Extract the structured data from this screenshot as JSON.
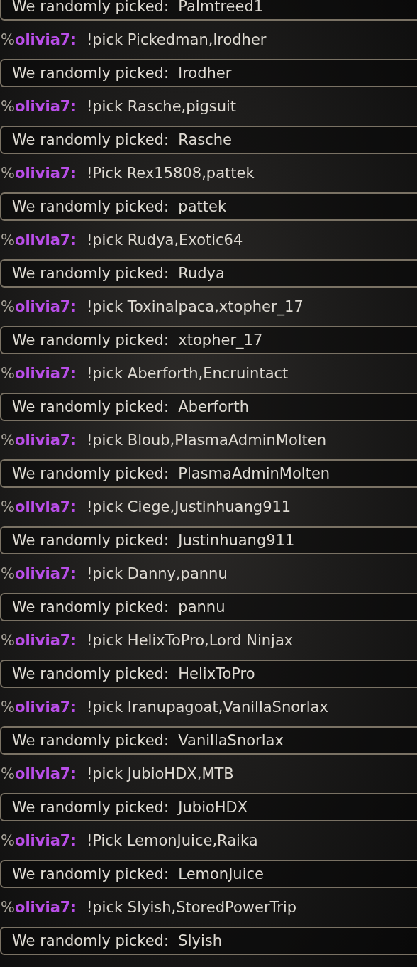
{
  "entries": [
    {
      "kind": "result",
      "text": "We randomly picked:  Palmtreed1"
    },
    {
      "kind": "chat",
      "rank": "%",
      "user": "olivia7:",
      "text": "!pick Pickedman,lrodher"
    },
    {
      "kind": "result",
      "text": "We randomly picked:  lrodher"
    },
    {
      "kind": "chat",
      "rank": "%",
      "user": "olivia7:",
      "text": "!pick Rasche,pigsuit"
    },
    {
      "kind": "result",
      "text": "We randomly picked:  Rasche"
    },
    {
      "kind": "chat",
      "rank": "%",
      "user": "olivia7:",
      "text": "!Pick Rex15808,pattek"
    },
    {
      "kind": "result",
      "text": "We randomly picked:  pattek"
    },
    {
      "kind": "chat",
      "rank": "%",
      "user": "olivia7:",
      "text": "!pick Rudya,Exotic64"
    },
    {
      "kind": "result",
      "text": "We randomly picked:  Rudya"
    },
    {
      "kind": "chat",
      "rank": "%",
      "user": "olivia7:",
      "text": "!pick Toxinalpaca,xtopher_17"
    },
    {
      "kind": "result",
      "text": "We randomly picked:  xtopher_17"
    },
    {
      "kind": "chat",
      "rank": "%",
      "user": "olivia7:",
      "text": "!pick Aberforth,Encruintact"
    },
    {
      "kind": "result",
      "text": "We randomly picked:  Aberforth"
    },
    {
      "kind": "chat",
      "rank": "%",
      "user": "olivia7:",
      "text": "!pick Bloub,PlasmaAdminMolten"
    },
    {
      "kind": "result",
      "text": "We randomly picked:  PlasmaAdminMolten"
    },
    {
      "kind": "chat",
      "rank": "%",
      "user": "olivia7:",
      "text": "!pick Ciege,Justinhuang911"
    },
    {
      "kind": "result",
      "text": "We randomly picked:  Justinhuang911"
    },
    {
      "kind": "chat",
      "rank": "%",
      "user": "olivia7:",
      "text": "!pick Danny,pannu"
    },
    {
      "kind": "result",
      "text": "We randomly picked:  pannu"
    },
    {
      "kind": "chat",
      "rank": "%",
      "user": "olivia7:",
      "text": "!pick HelixToPro,Lord Ninjax"
    },
    {
      "kind": "result",
      "text": "We randomly picked:  HelixToPro"
    },
    {
      "kind": "chat",
      "rank": "%",
      "user": "olivia7:",
      "text": "!pick Iranupagoat,VanillaSnorlax"
    },
    {
      "kind": "result",
      "text": "We randomly picked:  VanillaSnorlax"
    },
    {
      "kind": "chat",
      "rank": "%",
      "user": "olivia7:",
      "text": "!pick JubioHDX,MTB"
    },
    {
      "kind": "result",
      "text": "We randomly picked:  JubioHDX"
    },
    {
      "kind": "chat",
      "rank": "%",
      "user": "olivia7:",
      "text": "!Pick LemonJuice,Raika"
    },
    {
      "kind": "result",
      "text": "We randomly picked:  LemonJuice"
    },
    {
      "kind": "chat",
      "rank": "%",
      "user": "olivia7:",
      "text": "!pick Slyish,StoredPowerTrip"
    },
    {
      "kind": "result",
      "text": "We randomly picked:  Slyish"
    }
  ]
}
